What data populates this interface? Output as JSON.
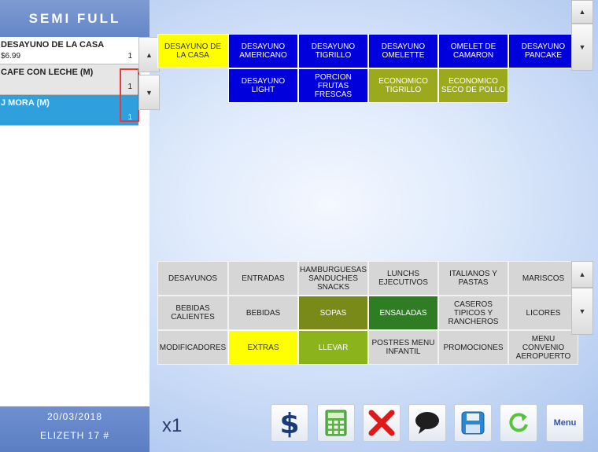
{
  "brand": {
    "title": "SEMI FULL"
  },
  "order": {
    "items": [
      {
        "name": "DESAYUNO DE LA CASA",
        "price": "$6.99",
        "qty": "1"
      },
      {
        "name": "CAFE CON LECHE (M)",
        "price": "",
        "qty": "1"
      },
      {
        "name": "J MORA (M)",
        "price": "",
        "qty": "1"
      }
    ]
  },
  "footer": {
    "date": "20/03/2018",
    "user": "ELIZETH 17 #"
  },
  "products": [
    "DESAYUNO DE LA CASA",
    "DESAYUNO AMERICANO",
    "DESAYUNO TIGRILLO",
    "DESAYUNO OMELETTE",
    "OMELET DE CAMARON",
    "DESAYUNO PANCAKE",
    "DESAYUNO LIGHT",
    "PORCION FRUTAS FRESCAS",
    "ECONOMICO TIGRILLO",
    "ECONOMICO SECO DE POLLO"
  ],
  "categories": [
    "DESAYUNOS",
    "ENTRADAS",
    "HAMBURGUESAS SANDUCHES SNACKS",
    "LUNCHS EJECUTIVOS",
    "ITALIANOS Y PASTAS",
    "MARISCOS",
    "BEBIDAS CALIENTES",
    "BEBIDAS",
    "SOPAS",
    "ENSALADAS",
    "CASEROS TIPICOS Y RANCHEROS",
    "LICORES",
    "MODIFICADORES",
    "EXTRAS",
    "LLEVAR",
    "POSTRES MENU INFANTIL",
    "PROMOCIONES",
    "MENU CONVENIO AEROPUERTO"
  ],
  "toolbar": {
    "multiplier": "x1",
    "menu_label": "Menu",
    "icons": [
      "dollar-icon",
      "calculator-icon",
      "delete-x-icon",
      "comment-icon",
      "save-icon",
      "refresh-icon"
    ]
  },
  "colors": {
    "yellow": "#ffff00",
    "blue": "#0000dd",
    "olive": "#9aaa1c",
    "gray": "#d6d6d6",
    "selected_row": "#2fa0dc",
    "header": "#6f8fcf"
  }
}
